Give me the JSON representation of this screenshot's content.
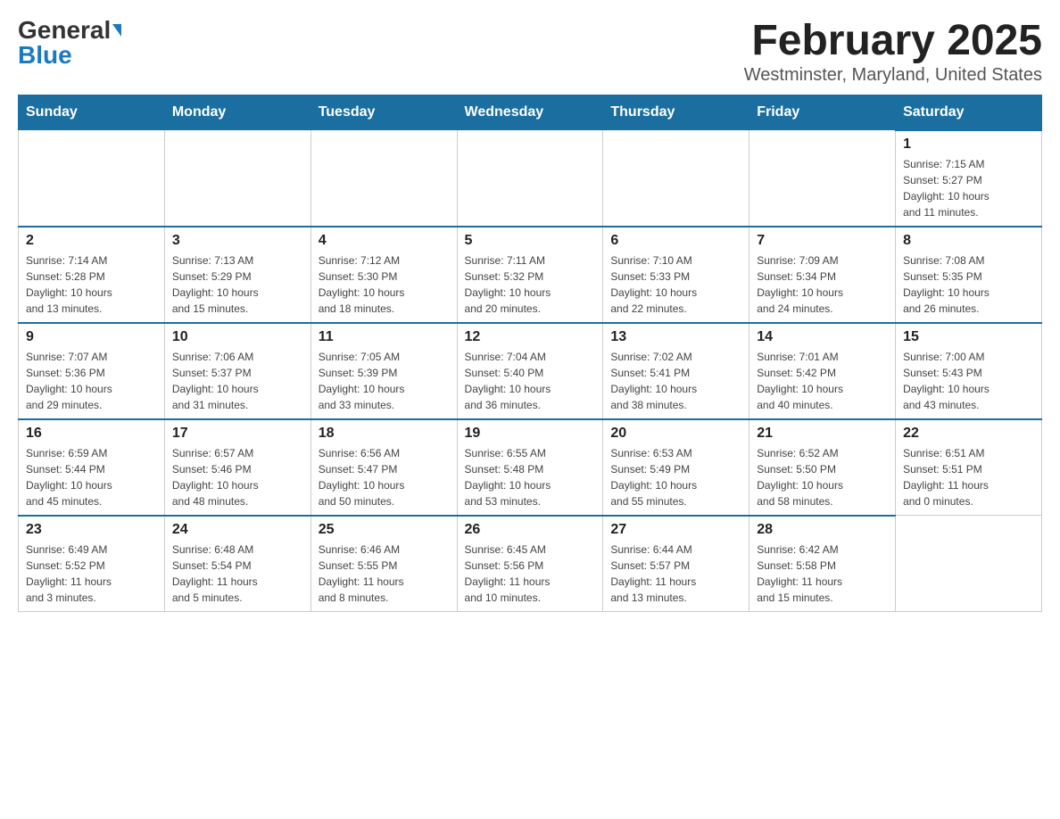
{
  "header": {
    "logo_general": "General",
    "logo_blue": "Blue",
    "title": "February 2025",
    "subtitle": "Westminster, Maryland, United States"
  },
  "days_of_week": [
    "Sunday",
    "Monday",
    "Tuesday",
    "Wednesday",
    "Thursday",
    "Friday",
    "Saturday"
  ],
  "weeks": [
    [
      {
        "day": "",
        "info": ""
      },
      {
        "day": "",
        "info": ""
      },
      {
        "day": "",
        "info": ""
      },
      {
        "day": "",
        "info": ""
      },
      {
        "day": "",
        "info": ""
      },
      {
        "day": "",
        "info": ""
      },
      {
        "day": "1",
        "info": "Sunrise: 7:15 AM\nSunset: 5:27 PM\nDaylight: 10 hours\nand 11 minutes."
      }
    ],
    [
      {
        "day": "2",
        "info": "Sunrise: 7:14 AM\nSunset: 5:28 PM\nDaylight: 10 hours\nand 13 minutes."
      },
      {
        "day": "3",
        "info": "Sunrise: 7:13 AM\nSunset: 5:29 PM\nDaylight: 10 hours\nand 15 minutes."
      },
      {
        "day": "4",
        "info": "Sunrise: 7:12 AM\nSunset: 5:30 PM\nDaylight: 10 hours\nand 18 minutes."
      },
      {
        "day": "5",
        "info": "Sunrise: 7:11 AM\nSunset: 5:32 PM\nDaylight: 10 hours\nand 20 minutes."
      },
      {
        "day": "6",
        "info": "Sunrise: 7:10 AM\nSunset: 5:33 PM\nDaylight: 10 hours\nand 22 minutes."
      },
      {
        "day": "7",
        "info": "Sunrise: 7:09 AM\nSunset: 5:34 PM\nDaylight: 10 hours\nand 24 minutes."
      },
      {
        "day": "8",
        "info": "Sunrise: 7:08 AM\nSunset: 5:35 PM\nDaylight: 10 hours\nand 26 minutes."
      }
    ],
    [
      {
        "day": "9",
        "info": "Sunrise: 7:07 AM\nSunset: 5:36 PM\nDaylight: 10 hours\nand 29 minutes."
      },
      {
        "day": "10",
        "info": "Sunrise: 7:06 AM\nSunset: 5:37 PM\nDaylight: 10 hours\nand 31 minutes."
      },
      {
        "day": "11",
        "info": "Sunrise: 7:05 AM\nSunset: 5:39 PM\nDaylight: 10 hours\nand 33 minutes."
      },
      {
        "day": "12",
        "info": "Sunrise: 7:04 AM\nSunset: 5:40 PM\nDaylight: 10 hours\nand 36 minutes."
      },
      {
        "day": "13",
        "info": "Sunrise: 7:02 AM\nSunset: 5:41 PM\nDaylight: 10 hours\nand 38 minutes."
      },
      {
        "day": "14",
        "info": "Sunrise: 7:01 AM\nSunset: 5:42 PM\nDaylight: 10 hours\nand 40 minutes."
      },
      {
        "day": "15",
        "info": "Sunrise: 7:00 AM\nSunset: 5:43 PM\nDaylight: 10 hours\nand 43 minutes."
      }
    ],
    [
      {
        "day": "16",
        "info": "Sunrise: 6:59 AM\nSunset: 5:44 PM\nDaylight: 10 hours\nand 45 minutes."
      },
      {
        "day": "17",
        "info": "Sunrise: 6:57 AM\nSunset: 5:46 PM\nDaylight: 10 hours\nand 48 minutes."
      },
      {
        "day": "18",
        "info": "Sunrise: 6:56 AM\nSunset: 5:47 PM\nDaylight: 10 hours\nand 50 minutes."
      },
      {
        "day": "19",
        "info": "Sunrise: 6:55 AM\nSunset: 5:48 PM\nDaylight: 10 hours\nand 53 minutes."
      },
      {
        "day": "20",
        "info": "Sunrise: 6:53 AM\nSunset: 5:49 PM\nDaylight: 10 hours\nand 55 minutes."
      },
      {
        "day": "21",
        "info": "Sunrise: 6:52 AM\nSunset: 5:50 PM\nDaylight: 10 hours\nand 58 minutes."
      },
      {
        "day": "22",
        "info": "Sunrise: 6:51 AM\nSunset: 5:51 PM\nDaylight: 11 hours\nand 0 minutes."
      }
    ],
    [
      {
        "day": "23",
        "info": "Sunrise: 6:49 AM\nSunset: 5:52 PM\nDaylight: 11 hours\nand 3 minutes."
      },
      {
        "day": "24",
        "info": "Sunrise: 6:48 AM\nSunset: 5:54 PM\nDaylight: 11 hours\nand 5 minutes."
      },
      {
        "day": "25",
        "info": "Sunrise: 6:46 AM\nSunset: 5:55 PM\nDaylight: 11 hours\nand 8 minutes."
      },
      {
        "day": "26",
        "info": "Sunrise: 6:45 AM\nSunset: 5:56 PM\nDaylight: 11 hours\nand 10 minutes."
      },
      {
        "day": "27",
        "info": "Sunrise: 6:44 AM\nSunset: 5:57 PM\nDaylight: 11 hours\nand 13 minutes."
      },
      {
        "day": "28",
        "info": "Sunrise: 6:42 AM\nSunset: 5:58 PM\nDaylight: 11 hours\nand 15 minutes."
      },
      {
        "day": "",
        "info": ""
      }
    ]
  ]
}
